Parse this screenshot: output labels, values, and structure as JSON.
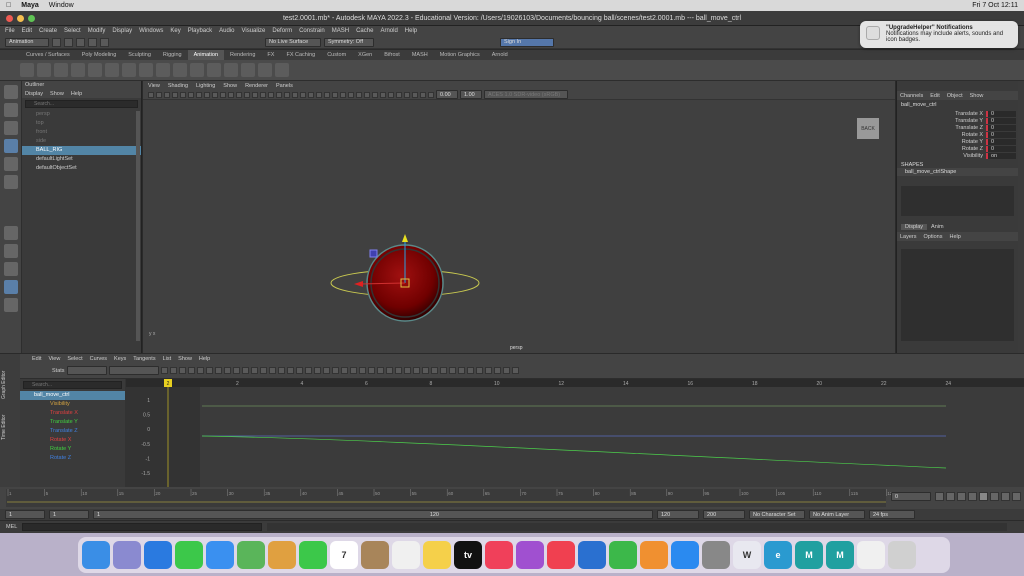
{
  "macbar": {
    "app": "Maya",
    "menu": [
      "Window"
    ],
    "clock": "Fri 7 Oct  12:11"
  },
  "title": "test2.0001.mb* - Autodesk MAYA 2022.3 - Educational Version: /Users/19026103/Documents/bouncing ball/scenes/test2.0001.mb  ---  ball_move_ctrl",
  "menubar": [
    "File",
    "Edit",
    "Create",
    "Select",
    "Modify",
    "Display",
    "Windows",
    "Key",
    "Playback",
    "Audio",
    "Visualize",
    "Deform",
    "Constrain",
    "MASH",
    "Cache",
    "Arnold",
    "Help"
  ],
  "status": {
    "mode": "Animation",
    "live_surface": "No Live Surface",
    "symmetry": "Symmetry: Off",
    "signin": "Sign In"
  },
  "shelf_tabs": [
    "Curves / Surfaces",
    "Poly Modeling",
    "Sculpting",
    "Rigging",
    "Animation",
    "Rendering",
    "FX",
    "FX Caching",
    "Custom",
    "XGen",
    "Bifrost",
    "MASH",
    "Motion Graphics",
    "Arnold"
  ],
  "shelf_active": "Animation",
  "outliner": {
    "title": "Outliner",
    "menu": [
      "Display",
      "Show",
      "Help"
    ],
    "search": "Search...",
    "items": [
      {
        "label": "persp",
        "dim": true
      },
      {
        "label": "top",
        "dim": true
      },
      {
        "label": "front",
        "dim": true
      },
      {
        "label": "side",
        "dim": true
      },
      {
        "label": "BALL_RIG",
        "sel": true
      },
      {
        "label": "defaultLightSet"
      },
      {
        "label": "defaultObjectSet"
      }
    ]
  },
  "viewport": {
    "menu": [
      "View",
      "Shading",
      "Lighting",
      "Show",
      "Renderer",
      "Panels"
    ],
    "camera": "persp",
    "back": "BACK",
    "field1": "0.00",
    "field2": "1.00",
    "colorspace": "ACES 1.0 SDR-video (sRGB)"
  },
  "channelbox": {
    "menu": [
      "Channels",
      "Edit",
      "Object",
      "Show"
    ],
    "object": "ball_move_ctrl",
    "channels": [
      {
        "name": "Translate X",
        "value": "0"
      },
      {
        "name": "Translate Y",
        "value": "0"
      },
      {
        "name": "Translate Z",
        "value": "0"
      },
      {
        "name": "Rotate X",
        "value": "0"
      },
      {
        "name": "Rotate Y",
        "value": "0"
      },
      {
        "name": "Rotate Z",
        "value": "0"
      },
      {
        "name": "Visibility",
        "value": "on"
      }
    ],
    "shapes_label": "SHAPES",
    "shape": "ball_move_ctrlShape",
    "tabs": [
      "Display",
      "Anim"
    ],
    "layer_menu": [
      "Layers",
      "Options",
      "Help"
    ]
  },
  "graph": {
    "menu": [
      "Edit",
      "View",
      "Select",
      "Curves",
      "Keys",
      "Tangents",
      "List",
      "Show",
      "Help"
    ],
    "stats": "Stats",
    "search": "Search...",
    "side_tabs": [
      "Graph Editor",
      "Time Editor"
    ],
    "root": "ball_move_ctrl",
    "attrs": [
      {
        "name": "Visibility",
        "color": "#d0a040"
      },
      {
        "name": "Translate X",
        "color": "#e04040"
      },
      {
        "name": "Translate Y",
        "color": "#40d040"
      },
      {
        "name": "Translate Z",
        "color": "#4080e0"
      },
      {
        "name": "Rotate X",
        "color": "#e04040"
      },
      {
        "name": "Rotate Y",
        "color": "#40d040"
      },
      {
        "name": "Rotate Z",
        "color": "#4080e0"
      }
    ],
    "frame_ticks": [
      "2",
      "4",
      "6",
      "8",
      "10",
      "12",
      "14",
      "16",
      "18",
      "20",
      "22",
      "24"
    ],
    "value_ticks": [
      "1",
      "0.5",
      "0",
      "-0.5",
      "-1",
      "-1.5"
    ],
    "current_frame": "2"
  },
  "timeline": {
    "ticks": [
      "1",
      "5",
      "10",
      "15",
      "20",
      "25",
      "30",
      "35",
      "40",
      "45",
      "50",
      "55",
      "60",
      "65",
      "70",
      "75",
      "80",
      "85",
      "90",
      "95",
      "100",
      "105",
      "110",
      "115",
      "120"
    ],
    "current": "0"
  },
  "range": {
    "start": "1",
    "start2": "1",
    "inner_start": "1",
    "inner_end": "120",
    "end": "120",
    "end2": "200",
    "character": "No Character Set",
    "anim_layer": "No Anim Layer",
    "fps": "24 fps"
  },
  "cmd": {
    "label": "MEL"
  },
  "notification": {
    "title": "\"UpgradeHelper\" Notifications",
    "body": "Notifications may include alerts, sounds and icon badges."
  },
  "dock": [
    {
      "name": "finder",
      "color": "#3a8ee6"
    },
    {
      "name": "launchpad",
      "color": "#8a8ad0"
    },
    {
      "name": "safari",
      "color": "#2a7ae0"
    },
    {
      "name": "messages",
      "color": "#3cc84a"
    },
    {
      "name": "mail",
      "color": "#3a90f0"
    },
    {
      "name": "maps",
      "color": "#5ab55a"
    },
    {
      "name": "photos",
      "color": "#e0a040"
    },
    {
      "name": "facetime",
      "color": "#3cc84a"
    },
    {
      "name": "calendar",
      "color": "#ffffff",
      "text": "7"
    },
    {
      "name": "contacts",
      "color": "#a8855a"
    },
    {
      "name": "reminders",
      "color": "#f0f0f0"
    },
    {
      "name": "notes",
      "color": "#f5d04a"
    },
    {
      "name": "tv",
      "color": "#111111",
      "text": "tv"
    },
    {
      "name": "music",
      "color": "#f0405a"
    },
    {
      "name": "podcasts",
      "color": "#a050d0"
    },
    {
      "name": "news",
      "color": "#f04050"
    },
    {
      "name": "keynote",
      "color": "#2a70d0"
    },
    {
      "name": "numbers",
      "color": "#3cb84a"
    },
    {
      "name": "pages",
      "color": "#f09030"
    },
    {
      "name": "appstore",
      "color": "#2a8af0"
    },
    {
      "name": "settings",
      "color": "#888888"
    },
    {
      "name": "word-like",
      "color": "#e8e8f0",
      "text": "W"
    },
    {
      "name": "edge",
      "color": "#2a9ad0",
      "text": "e"
    },
    {
      "name": "maya",
      "color": "#20a0a0",
      "text": "M"
    },
    {
      "name": "maya2",
      "color": "#20a0a0",
      "text": "M"
    },
    {
      "name": "preview",
      "color": "#f0f0f0"
    },
    {
      "name": "trash",
      "color": "#d0d0d0"
    }
  ]
}
